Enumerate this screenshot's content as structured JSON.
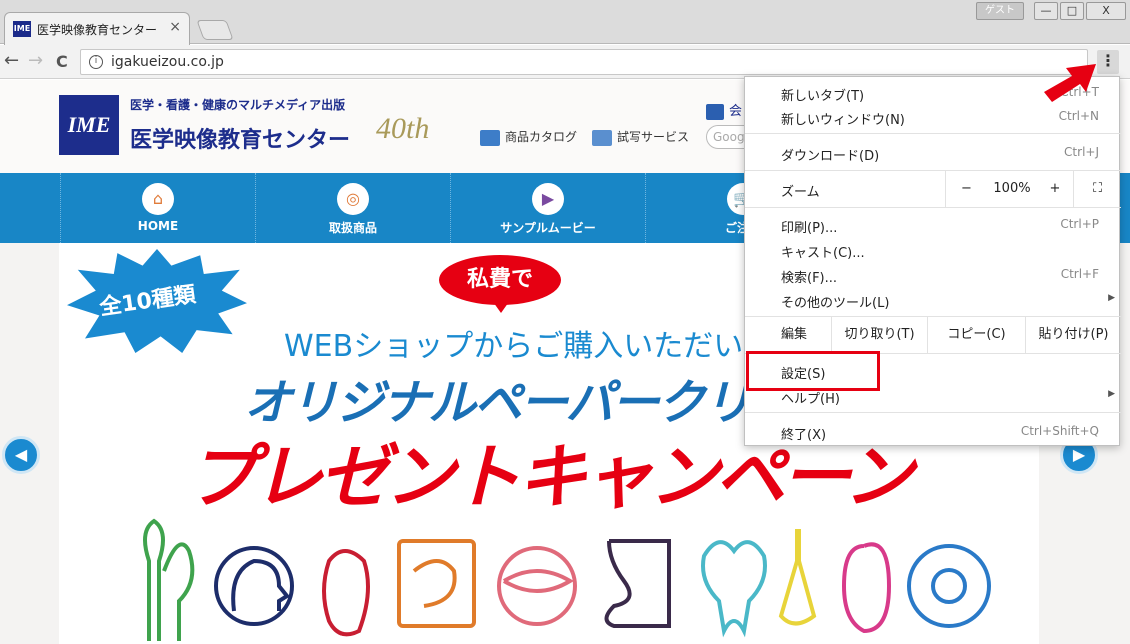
{
  "window": {
    "tab_title": "医学映像教育センター",
    "tab_favicon": "IME",
    "tab_close": "×",
    "guest_label": "ゲスト",
    "minimize": "—",
    "maximize": "□",
    "close": "X"
  },
  "toolbar": {
    "back": "←",
    "forward": "→",
    "reload": "C",
    "info": "i",
    "url": "igakueizou.co.jp",
    "menu": "⋮"
  },
  "header": {
    "logo_text": "IME",
    "tagline": "医学・看護・健康のマルチメディア出版",
    "site_name": "医学映像教育センター",
    "anniversary": "40th",
    "catalog_link": "商品カタログ",
    "trial_link": "試写サービス",
    "company_label": "会",
    "search_placeholder": "Googl"
  },
  "nav": {
    "items": [
      {
        "label": "HOME",
        "icon": "⌂"
      },
      {
        "label": "取扱商品",
        "icon": "◎"
      },
      {
        "label": "サンプルムービー",
        "icon": "▶"
      },
      {
        "label": "ご注文",
        "icon": "🛒"
      }
    ]
  },
  "banner": {
    "burst": "全10種類",
    "pill": "私費で",
    "line1": "WEBショップからご購入いただいた方",
    "line2": "オリジナルペーパークリ",
    "line3": "プレゼントキャンペーン",
    "prev": "◀",
    "next": "▶"
  },
  "menu": {
    "new_tab": "新しいタブ(T)",
    "new_tab_shortcut": "Ctrl+T",
    "new_window": "新しいウィンドウ(N)",
    "new_window_shortcut": "Ctrl+N",
    "download": "ダウンロード(D)",
    "download_shortcut": "Ctrl+J",
    "zoom": "ズーム",
    "zoom_minus": "−",
    "zoom_value": "100%",
    "zoom_plus": "+",
    "fullscreen": "⛶",
    "print": "印刷(P)...",
    "print_shortcut": "Ctrl+P",
    "cast": "キャスト(C)...",
    "find": "検索(F)...",
    "find_shortcut": "Ctrl+F",
    "more_tools": "その他のツール(L)",
    "edit": "編集",
    "cut": "切り取り(T)",
    "copy": "コピー(C)",
    "paste": "貼り付け(P)",
    "settings": "設定(S)",
    "help": "ヘルプ(H)",
    "exit": "終了(X)",
    "exit_shortcut": "Ctrl+Shift+Q",
    "submenu_arrow": "▶"
  },
  "colors": {
    "nav_blue": "#1886c6",
    "brand_navy": "#1d2d8c",
    "accent_red": "#e60012"
  }
}
